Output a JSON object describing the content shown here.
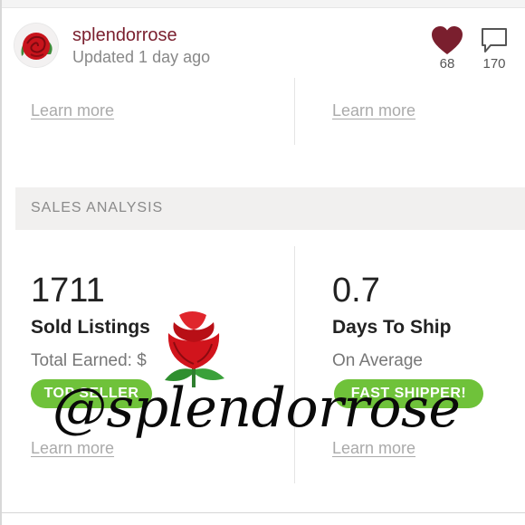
{
  "header": {
    "username": "splendorrose",
    "updated": "Updated 1 day ago",
    "likes": "68",
    "comments": "170",
    "like_icon": "heart-icon",
    "comment_icon": "comment-bubble-icon",
    "accent_color": "#7a1f2e"
  },
  "top_links": {
    "left": "Learn more",
    "right": "Learn more"
  },
  "section": {
    "title": "SALES ANALYSIS"
  },
  "stats": [
    {
      "value": "1711",
      "label": "Sold Listings",
      "sub": "Total Earned: $",
      "badge": "TOP SELLER",
      "link": "Learn more"
    },
    {
      "value": "0.7",
      "label": "Days To Ship",
      "sub": "On Average",
      "badge": "FAST SHIPPER!",
      "link": "Learn more"
    }
  ],
  "badge_color": "#6fc23a",
  "overlay": {
    "watermark": "@splendorrose",
    "icon": "rose-icon"
  }
}
